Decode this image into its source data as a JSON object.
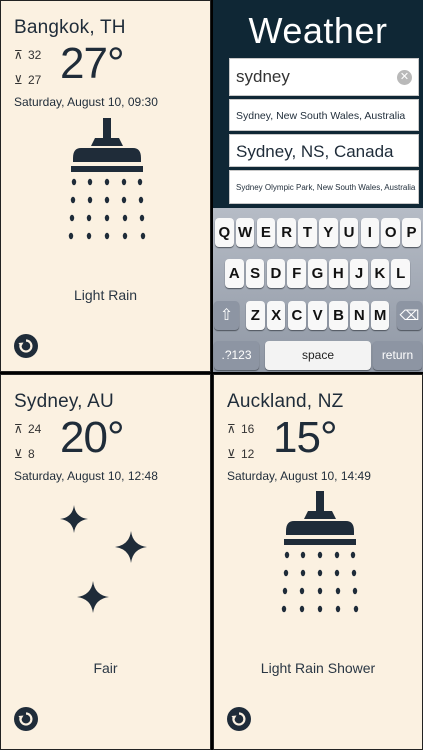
{
  "bangkok": {
    "city": "Bangkok, TH",
    "high": "32",
    "low": "27",
    "temp": "27°",
    "date": "Saturday, August 10, 09:30",
    "condition": "Light Rain",
    "icon": "shower-icon"
  },
  "sydney": {
    "city": "Sydney, AU",
    "high": "24",
    "low": "8",
    "temp": "20°",
    "date": "Saturday, August 10, 12:48",
    "condition": "Fair",
    "icon": "sparkle-icon"
  },
  "auckland": {
    "city": "Auckland, NZ",
    "high": "16",
    "low": "12",
    "temp": "15°",
    "date": "Saturday, August 10, 14:49",
    "condition": "Light Rain Shower",
    "icon": "shower-icon"
  },
  "search": {
    "title": "Weather",
    "query": "sydney",
    "suggestions": [
      "Sydney, New South Wales, Australia",
      "Sydney, NS, Canada",
      "Sydney Olympic Park, New South Wales, Australia"
    ]
  },
  "keyboard": {
    "row1": [
      "Q",
      "W",
      "E",
      "R",
      "T",
      "Y",
      "U",
      "I",
      "O",
      "P"
    ],
    "row2": [
      "A",
      "S",
      "D",
      "F",
      "G",
      "H",
      "J",
      "K",
      "L"
    ],
    "row3": [
      "Z",
      "X",
      "C",
      "V",
      "B",
      "N",
      "M"
    ],
    "numbers_key": ".?123",
    "space_key": "space",
    "return_key": "return"
  },
  "colors": {
    "panel_bg": "#fbf1e1",
    "ink": "#1f2c39",
    "search_bg": "#0f2735"
  }
}
